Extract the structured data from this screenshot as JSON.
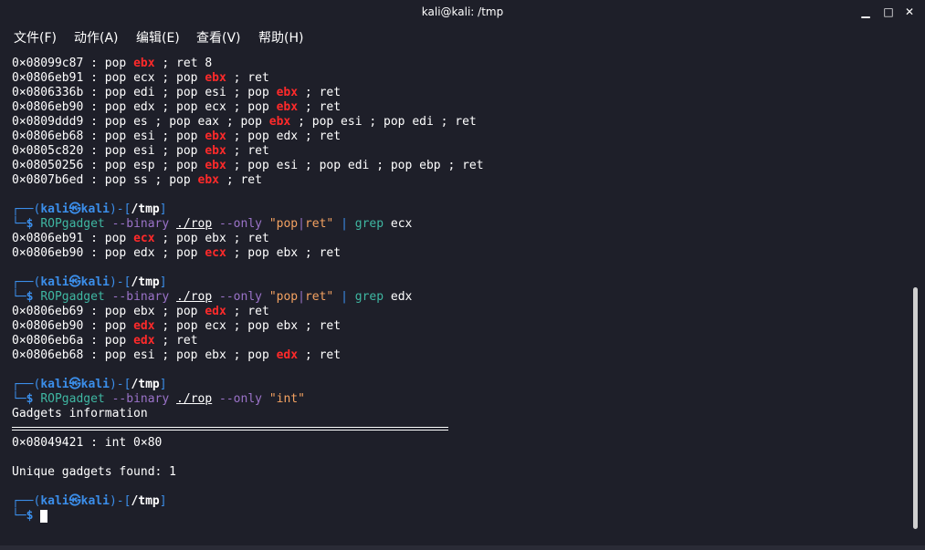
{
  "window": {
    "title": "kali@kali: /tmp",
    "minimize_glyph": "▁",
    "maximize_glyph": "□",
    "close_glyph": "✕"
  },
  "menu": [
    "文件(F)",
    "动作(A)",
    "编辑(E)",
    "查看(V)",
    "帮助(H)"
  ],
  "prompt": {
    "user": "kali",
    "at": "㉿",
    "host": "kali",
    "cwd": "/tmp",
    "dollar": "$"
  },
  "terminal": {
    "gadgets_top": [
      {
        "addr": "0×08099c87",
        "a": "pop ",
        "r": "ebx",
        "b": " ; ret 8"
      },
      {
        "addr": "0×0806eb91",
        "a": "pop ecx ; pop ",
        "r": "ebx",
        "b": " ; ret"
      },
      {
        "addr": "0×0806336b",
        "a": "pop edi ; pop esi ; pop ",
        "r": "ebx",
        "b": " ; ret"
      },
      {
        "addr": "0×0806eb90",
        "a": "pop edx ; pop ecx ; pop ",
        "r": "ebx",
        "b": " ; ret"
      },
      {
        "addr": "0×0809ddd9",
        "a": "pop es ; pop eax ; pop ",
        "r": "ebx",
        "b": " ; pop esi ; pop edi ; ret"
      },
      {
        "addr": "0×0806eb68",
        "a": "pop esi ; pop ",
        "r": "ebx",
        "b": " ; pop edx ; ret"
      },
      {
        "addr": "0×0805c820",
        "a": "pop esi ; pop ",
        "r": "ebx",
        "b": " ; ret"
      },
      {
        "addr": "0×08050256",
        "a": "pop esp ; pop ",
        "r": "ebx",
        "b": " ; pop esi ; pop edi ; pop ebp ; ret"
      },
      {
        "addr": "0×0807b6ed",
        "a": "pop ss ; pop ",
        "r": "ebx",
        "b": " ; ret"
      }
    ],
    "cmd1": {
      "tool": "ROPgadget",
      "opt1": "--binary",
      "file": "./rop",
      "opt2": "--only",
      "q1": "\"pop",
      "bar": "|",
      "q2": "ret\"",
      "pipe": "|",
      "grep": "grep",
      "arg": "ecx"
    },
    "gadgets_ecx": [
      {
        "addr": "0×0806eb91",
        "a": "pop ",
        "r": "ecx",
        "b": " ; pop ebx ; ret"
      },
      {
        "addr": "0×0806eb90",
        "a": "pop edx ; pop ",
        "r": "ecx",
        "b": " ; pop ebx ; ret"
      }
    ],
    "cmd2": {
      "tool": "ROPgadget",
      "opt1": "--binary",
      "file": "./rop",
      "opt2": "--only",
      "q1": "\"pop",
      "bar": "|",
      "q2": "ret\"",
      "pipe": "|",
      "grep": "grep",
      "arg": "edx"
    },
    "gadgets_edx": [
      {
        "addr": "0×0806eb69",
        "a": "pop ebx ; pop ",
        "r": "edx",
        "b": " ; ret"
      },
      {
        "addr": "0×0806eb90",
        "a": "pop ",
        "r": "edx",
        "b": " ; pop ecx ; pop ebx ; ret"
      },
      {
        "addr": "0×0806eb6a",
        "a": "pop ",
        "r": "edx",
        "b": " ; ret"
      },
      {
        "addr": "0×0806eb68",
        "a": "pop esi ; pop ebx ; pop ",
        "r": "edx",
        "b": " ; ret"
      }
    ],
    "cmd3": {
      "tool": "ROPgadget",
      "opt1": "--binary",
      "file": "./rop",
      "opt2": "--only",
      "q": "\"int\""
    },
    "gadgets_info": "Gadgets information",
    "int_gadget": "0×08049421 : int 0×80",
    "unique": "Unique gadgets found: 1"
  },
  "colors": {
    "background": "#1e1f29",
    "register": "#ff2a2a",
    "prompt": "#3b8eea",
    "command": "#3fb7a2",
    "option": "#9b73c9",
    "string": "#f4a261"
  }
}
